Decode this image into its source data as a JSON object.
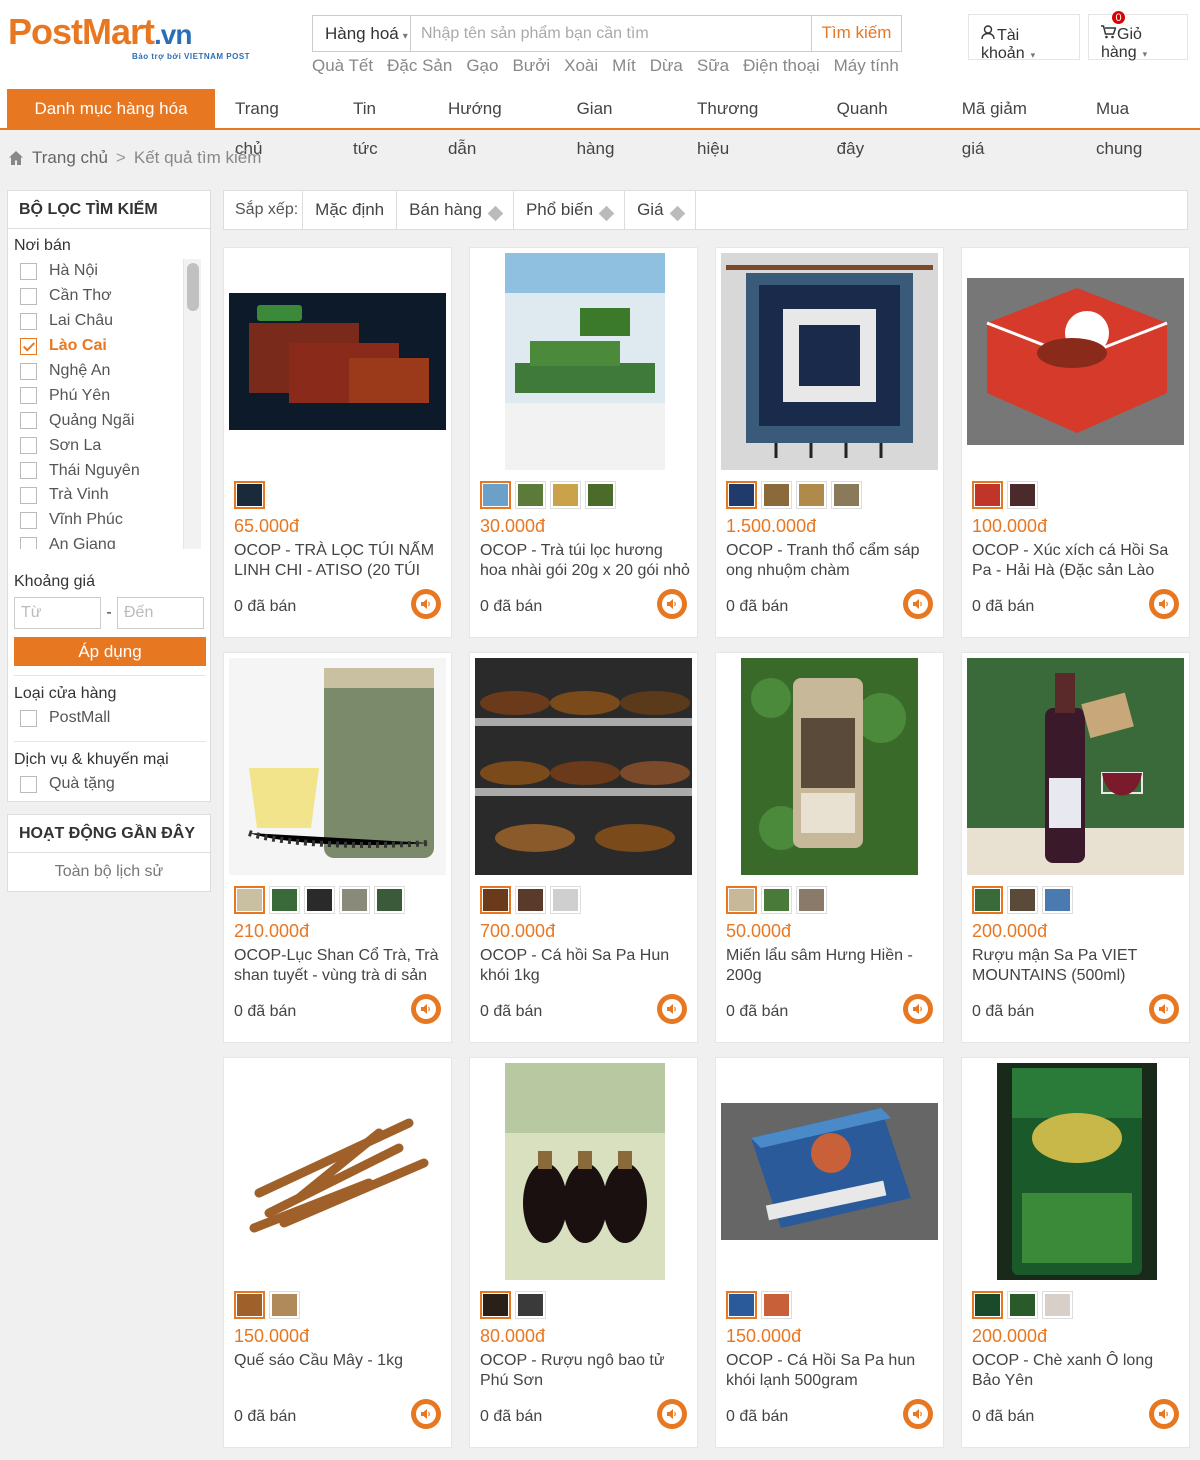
{
  "header": {
    "logo": {
      "post": "Post",
      "mart": "Mart",
      "vn": ".vn",
      "sub": "Bảo trợ bởi VIETNAM POST"
    },
    "search": {
      "category": "Hàng hoá",
      "placeholder": "Nhập tên sản phẩm bạn cần tìm",
      "button": "Tìm kiếm"
    },
    "quick_links": [
      "Quà Tết",
      "Đặc Sản",
      "Gạo",
      "Bưởi",
      "Xoài",
      "Mít",
      "Dừa",
      "Sữa",
      "Điện thoại",
      "Máy tính"
    ],
    "account": {
      "line1": "Tài",
      "line2": "khoản"
    },
    "cart": {
      "line1": "Giỏ",
      "line2": "hàng",
      "count": "0"
    }
  },
  "nav": {
    "category_button": "Danh mục hàng hóa",
    "links": [
      "Trang chủ",
      "Tin tức",
      "Hướng dẫn",
      "Gian hàng",
      "Thương hiệu",
      "Quanh đây",
      "Mã giảm giá",
      "Mua chung"
    ]
  },
  "breadcrumb": {
    "home": "Trang chủ",
    "separator": ">",
    "current": "Kết quả tìm kiếm"
  },
  "filter": {
    "title": "BỘ LỌC TÌM KIẾM",
    "location_label": "Nơi bán",
    "locations": [
      {
        "name": "Hà Nội",
        "checked": false
      },
      {
        "name": "Cần Thơ",
        "checked": false
      },
      {
        "name": "Lai Châu",
        "checked": false
      },
      {
        "name": "Lào Cai",
        "checked": true
      },
      {
        "name": "Nghệ An",
        "checked": false
      },
      {
        "name": "Phú Yên",
        "checked": false
      },
      {
        "name": "Quảng Ngãi",
        "checked": false
      },
      {
        "name": "Sơn La",
        "checked": false
      },
      {
        "name": "Thái Nguyên",
        "checked": false
      },
      {
        "name": "Trà Vinh",
        "checked": false
      },
      {
        "name": "Vĩnh Phúc",
        "checked": false
      },
      {
        "name": "An Giang",
        "checked": false
      }
    ],
    "price_label": "Khoảng giá",
    "price_from": "Từ",
    "price_to": "Đến",
    "price_dash": "-",
    "apply": "Áp dụng",
    "store_type_label": "Loại cửa hàng",
    "store_type_option": "PostMall",
    "services_label": "Dịch vụ & khuyến mại",
    "services_option": "Quà tặng"
  },
  "recent": {
    "title": "HOẠT ĐỘNG GẦN ĐÂY",
    "history": "Toàn bộ lịch sử"
  },
  "sort": {
    "label": "Sắp xếp:",
    "options": [
      "Mặc định",
      "Bán hàng",
      "Phổ biến",
      "Giá"
    ]
  },
  "products": [
    {
      "price": "65.000đ",
      "name": "OCOP - TRÀ LỌC TÚI NẤM LINH CHI - ATISO (20 TÚI",
      "sold": "0 đã bán",
      "thumbs": [
        "#1b2a3a"
      ]
    },
    {
      "price": "30.000đ",
      "name": "OCOP - Trà túi lọc hương hoa nhài gói 20g x 20 gói nhỏ -",
      "sold": "0 đã bán",
      "thumbs": [
        "#6ba0c8",
        "#5c7a3a",
        "#c9a24a",
        "#4a6b2a"
      ]
    },
    {
      "price": "1.500.000đ",
      "name": "OCOP - Tranh thổ cẩm sáp ong nhuộm chàm",
      "sold": "0 đã bán",
      "thumbs": [
        "#1f3a6b",
        "#8a6a3a",
        "#b08a4a",
        "#8a7a5a"
      ]
    },
    {
      "price": "100.000đ",
      "name": "OCOP - Xúc xích cá Hồi Sa Pa - Hải Hà (Đặc sản Lào Cai)",
      "sold": "0 đã bán",
      "thumbs": [
        "#c0342a",
        "#4a2a2a"
      ]
    },
    {
      "price": "210.000đ",
      "name": "OCOP-Lục Shan Cổ Trà, Trà shan tuyết - vùng trà di sản",
      "sold": "0 đã bán",
      "thumbs": [
        "#c8c0a0",
        "#3a6a3a",
        "#2a2a2a",
        "#8a8a7a",
        "#3a5a3a"
      ]
    },
    {
      "price": "700.000đ",
      "name": "OCOP - Cá hồi Sa Pa Hun khói 1kg",
      "sold": "0 đã bán",
      "thumbs": [
        "#6a3a1a",
        "#5a3a2a",
        "#cfcfcf"
      ]
    },
    {
      "price": "50.000đ",
      "name": "Miến lẩu sâm Hưng Hiền - 200g",
      "sold": "0 đã bán",
      "thumbs": [
        "#c8b89a",
        "#4a7a3a",
        "#8a7a6a"
      ]
    },
    {
      "price": "200.000đ",
      "name": "Rượu mận Sa Pa VIET MOUNTAINS (500ml)",
      "sold": "0 đã bán",
      "thumbs": [
        "#3a6a3a",
        "#5a4a3a",
        "#4a7ab0"
      ]
    },
    {
      "price": "150.000đ",
      "name": "Quế sáo Cầu Mây - 1kg",
      "sold": "0 đã bán",
      "thumbs": [
        "#a0602a",
        "#b08a5a"
      ]
    },
    {
      "price": "80.000đ",
      "name": "OCOP - Rượu ngô bao tử Phú Sơn",
      "sold": "0 đã bán",
      "thumbs": [
        "#2a2018",
        "#3a3a3a"
      ]
    },
    {
      "price": "150.000đ",
      "name": "OCOP - Cá Hồi Sa Pa hun khói lạnh 500gram",
      "sold": "0 đã bán",
      "thumbs": [
        "#2a5a9a",
        "#c8603a"
      ]
    },
    {
      "price": "200.000đ",
      "name": "OCOP - Chè xanh Ô long Bảo Yên",
      "sold": "0 đã bán",
      "thumbs": [
        "#1a4a2a",
        "#2a5a2a",
        "#d8d0c8"
      ]
    }
  ],
  "colors": {
    "accent": "#e87722",
    "link": "#2a6fb5"
  }
}
